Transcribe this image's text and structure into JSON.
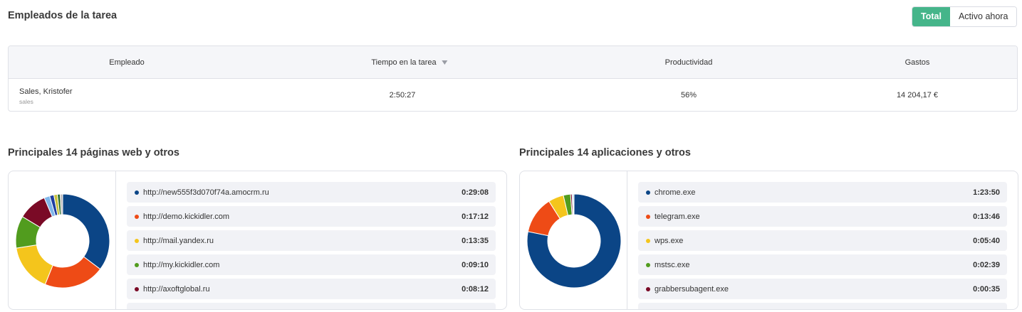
{
  "header": {
    "title": "Empleados de la tarea",
    "toggle": {
      "total_label": "Total",
      "active_label": "Activo ahora",
      "selected": "Total"
    }
  },
  "table": {
    "columns": [
      "Empleado",
      "Tiempo en la tarea",
      "Productividad",
      "Gastos"
    ],
    "sorted_column": "Tiempo en la tarea",
    "rows": [
      {
        "name": "Sales, Kristofer",
        "group": "sales",
        "time": "2:50:27",
        "productivity": "56%",
        "expenses": "14 204,17 €"
      }
    ]
  },
  "websites": {
    "title": "Principales 14 páginas web y otros",
    "items": [
      {
        "label": "http://new555f3d070f74a.amocrm.ru",
        "time": "0:29:08",
        "color": "#0b4586"
      },
      {
        "label": "http://demo.kickidler.com",
        "time": "0:17:12",
        "color": "#ee4b16"
      },
      {
        "label": "http://mail.yandex.ru",
        "time": "0:13:35",
        "color": "#f4c51c"
      },
      {
        "label": "http://my.kickidler.com",
        "time": "0:09:10",
        "color": "#519c1e"
      },
      {
        "label": "http://axoftglobal.ru",
        "time": "0:08:12",
        "color": "#7a0a26"
      }
    ],
    "chart_colors": [
      "#0b4586",
      "#ee4b16",
      "#f4c51c",
      "#519c1e",
      "#7a0a26",
      "#7fb6ea",
      "#1e3ea0",
      "#c8c03a",
      "#2a6b2a",
      "#bdb8b8"
    ],
    "chart_values": [
      29.13,
      17.2,
      13.58,
      9.17,
      8.2,
      1.6,
      1.2,
      1.0,
      0.8,
      0.7
    ]
  },
  "apps": {
    "title": "Principales 14 aplicaciones y otros",
    "items": [
      {
        "label": "chrome.exe",
        "time": "1:23:50",
        "color": "#0b4586"
      },
      {
        "label": "telegram.exe",
        "time": "0:13:46",
        "color": "#ee4b16"
      },
      {
        "label": "wps.exe",
        "time": "0:05:40",
        "color": "#f4c51c"
      },
      {
        "label": "mstsc.exe",
        "time": "0:02:39",
        "color": "#519c1e"
      },
      {
        "label": "grabbersubagent.exe",
        "time": "0:00:35",
        "color": "#7a0a26"
      }
    ],
    "chart_colors": [
      "#0b4586",
      "#ee4b16",
      "#f4c51c",
      "#519c1e",
      "#7a0a26",
      "#7fb6ea",
      "#1e3ea0"
    ],
    "chart_values": [
      83.83,
      13.77,
      5.67,
      2.65,
      0.58,
      0.4,
      0.3
    ]
  }
}
